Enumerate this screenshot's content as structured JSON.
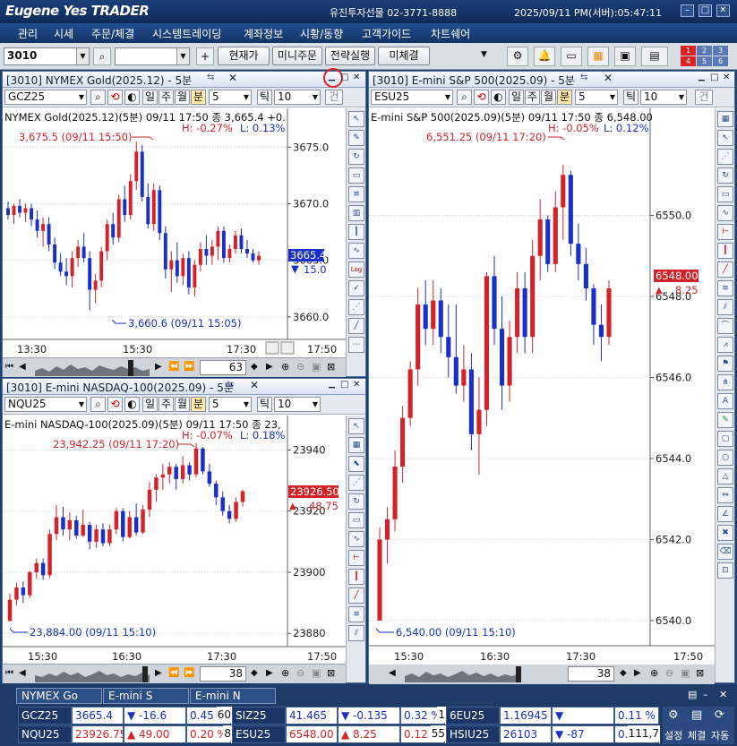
{
  "app": {
    "logo": "Eugene Yes TRADER",
    "company": "유진투자선물 02-3771-8888",
    "clock": "2025/09/11  PM(서버):05:47:11"
  },
  "menu": [
    "관리",
    "시세",
    "주문/체결",
    "시스템트레이딩",
    "계좌정보",
    "시황/동향",
    "고객가이드",
    "차트쉐어"
  ],
  "toolbar": {
    "screen_no": "3010",
    "buttons": [
      "현재가",
      "미니주문",
      "전략실행",
      "미체결"
    ],
    "badges": [
      "1",
      "2",
      "3",
      "4",
      "5",
      "6"
    ]
  },
  "chart_common": {
    "periods": [
      "일",
      "주",
      "월",
      "분"
    ],
    "minutes": "5",
    "tick_label": "틱",
    "tick_value": "10",
    "jump": "건"
  },
  "colors": {
    "up": "#d2232a",
    "down": "#1a2fc8"
  },
  "panes": {
    "gold": {
      "title": "[3010] NYMEX Gold(2025.12) - 5분",
      "symbol": "GCZ25",
      "info": "NYMEX Gold(2025.12)(5분) 09/11 17:50  종 3,665.4 +0.",
      "hl": "H: -0.27%",
      "lo_pct": "L: 0.13%",
      "high_mark": "3,675.5 (09/11 15:50)",
      "low_mark": "3,660.6 (09/11 15:05)",
      "last_tag": "3665.4",
      "change_tag": "15.0",
      "times": [
        "13:30",
        "15:30",
        "17:30",
        "17:50"
      ],
      "zoom": "63",
      "chart_data": {
        "type": "candlestick",
        "ylim": [
          3658.8,
          3677.0
        ],
        "yticks": [
          3675.0,
          3670.0,
          3665.0,
          3660.0
        ],
        "candles": [
          [
            3669.6,
            3670.2,
            3668.6,
            3669.0
          ],
          [
            3669.0,
            3670.0,
            3668.2,
            3669.8
          ],
          [
            3669.8,
            3670.4,
            3668.8,
            3669.2
          ],
          [
            3669.2,
            3670.0,
            3668.4,
            3669.6
          ],
          [
            3669.6,
            3670.0,
            3668.0,
            3668.6
          ],
          [
            3668.6,
            3669.4,
            3667.0,
            3667.6
          ],
          [
            3667.6,
            3668.8,
            3666.2,
            3668.2
          ],
          [
            3668.2,
            3668.8,
            3665.8,
            3666.4
          ],
          [
            3666.4,
            3667.0,
            3664.2,
            3664.8
          ],
          [
            3664.8,
            3665.6,
            3663.6,
            3664.0
          ],
          [
            3664.0,
            3665.2,
            3662.8,
            3663.6
          ],
          [
            3663.6,
            3665.8,
            3662.6,
            3665.2
          ],
          [
            3665.2,
            3666.8,
            3664.4,
            3666.2
          ],
          [
            3666.2,
            3667.4,
            3664.8,
            3665.2
          ],
          [
            3665.2,
            3665.8,
            3660.6,
            3662.4
          ],
          [
            3662.4,
            3663.8,
            3661.2,
            3663.2
          ],
          [
            3663.2,
            3666.2,
            3662.6,
            3665.8
          ],
          [
            3665.8,
            3668.6,
            3665.0,
            3668.2
          ],
          [
            3668.2,
            3669.2,
            3666.4,
            3667.0
          ],
          [
            3667.0,
            3670.8,
            3666.6,
            3670.4
          ],
          [
            3670.4,
            3671.6,
            3668.4,
            3669.0
          ],
          [
            3669.0,
            3672.6,
            3668.6,
            3672.0
          ],
          [
            3672.0,
            3675.5,
            3671.2,
            3674.6
          ],
          [
            3674.6,
            3675.2,
            3670.2,
            3670.6
          ],
          [
            3670.6,
            3671.8,
            3667.8,
            3668.2
          ],
          [
            3668.2,
            3671.8,
            3667.6,
            3671.2
          ],
          [
            3671.2,
            3671.6,
            3666.8,
            3667.4
          ],
          [
            3667.4,
            3668.0,
            3663.4,
            3664.2
          ],
          [
            3664.2,
            3665.8,
            3662.2,
            3665.0
          ],
          [
            3665.0,
            3666.6,
            3663.0,
            3663.6
          ],
          [
            3663.6,
            3665.6,
            3662.8,
            3665.2
          ],
          [
            3665.2,
            3665.8,
            3662.0,
            3662.6
          ],
          [
            3662.6,
            3665.0,
            3661.8,
            3664.6
          ],
          [
            3664.6,
            3666.6,
            3664.0,
            3666.0
          ],
          [
            3666.0,
            3667.2,
            3664.6,
            3665.4
          ],
          [
            3665.4,
            3666.8,
            3664.6,
            3666.2
          ],
          [
            3666.2,
            3668.0,
            3665.0,
            3667.6
          ],
          [
            3667.6,
            3668.0,
            3664.8,
            3665.2
          ],
          [
            3665.2,
            3666.4,
            3664.8,
            3666.0
          ],
          [
            3666.0,
            3667.6,
            3665.6,
            3667.2
          ],
          [
            3667.2,
            3667.8,
            3665.6,
            3666.0
          ],
          [
            3666.0,
            3666.8,
            3665.2,
            3665.6
          ],
          [
            3665.6,
            3666.0,
            3664.8,
            3665.0
          ],
          [
            3665.0,
            3665.8,
            3664.6,
            3665.4
          ]
        ]
      }
    },
    "nasdaq": {
      "title": "[3010] E-mini NASDAQ-100(2025.09) - 5분",
      "symbol": "NQU25",
      "info": "E-mini NASDAQ-100(2025.09)(5분) 09/11 17:50  종 23,",
      "hl": "H: -0.07%",
      "lo_pct": "L: 0.18%",
      "high_mark": "23,942.25 (09/11 17:20)",
      "low_mark": "23,884.00 (09/11 15:10)",
      "last_tag": "23926.50",
      "change_tag": "48.75",
      "times": [
        "15:30",
        "16:30",
        "17:30",
        "17:50"
      ],
      "zoom": "38",
      "chart_data": {
        "type": "candlestick",
        "ylim": [
          23878,
          23946
        ],
        "yticks": [
          23940,
          23920,
          23900,
          23880
        ],
        "candles": [
          [
            23884.0,
            23893.0,
            23884.0,
            23891.0
          ],
          [
            23891.0,
            23896.5,
            23889.0,
            23895.0
          ],
          [
            23895.0,
            23897.0,
            23890.0,
            23892.5
          ],
          [
            23892.5,
            23900.5,
            23891.5,
            23900.0
          ],
          [
            23900.0,
            23904.5,
            23898.0,
            23903.0
          ],
          [
            23903.0,
            23904.5,
            23897.5,
            23899.0
          ],
          [
            23899.0,
            23914.0,
            23898.0,
            23912.5
          ],
          [
            23912.5,
            23922.0,
            23910.5,
            23918.0
          ],
          [
            23918.0,
            23921.5,
            23912.0,
            23914.0
          ],
          [
            23914.0,
            23919.5,
            23910.5,
            23917.0
          ],
          [
            23917.0,
            23918.5,
            23911.0,
            23912.0
          ],
          [
            23912.0,
            23920.5,
            23911.5,
            23915.5
          ],
          [
            23915.5,
            23916.5,
            23907.5,
            23910.0
          ],
          [
            23910.0,
            23915.5,
            23908.0,
            23914.0
          ],
          [
            23914.0,
            23916.0,
            23908.5,
            23909.5
          ],
          [
            23909.5,
            23915.5,
            23908.5,
            23914.0
          ],
          [
            23914.0,
            23921.0,
            23912.5,
            23920.0
          ],
          [
            23920.0,
            23921.0,
            23910.0,
            23911.5
          ],
          [
            23911.5,
            23920.0,
            23911.0,
            23918.0
          ],
          [
            23918.0,
            23922.5,
            23912.0,
            23913.0
          ],
          [
            23913.0,
            23922.0,
            23912.5,
            23920.5
          ],
          [
            23920.5,
            23929.5,
            23918.0,
            23927.0
          ],
          [
            23927.0,
            23932.0,
            23923.0,
            23931.0
          ],
          [
            23931.0,
            23935.5,
            23927.0,
            23932.0
          ],
          [
            23932.0,
            23936.0,
            23929.0,
            23934.5
          ],
          [
            23934.5,
            23935.5,
            23927.0,
            23930.5
          ],
          [
            23930.5,
            23938.0,
            23929.0,
            23935.0
          ],
          [
            23935.0,
            23936.0,
            23930.0,
            23932.0
          ],
          [
            23932.0,
            23942.25,
            23931.0,
            23940.5
          ],
          [
            23940.5,
            23941.0,
            23932.0,
            23933.0
          ],
          [
            23933.0,
            23935.5,
            23928.0,
            23929.0
          ],
          [
            23929.0,
            23930.0,
            23922.0,
            23924.5
          ],
          [
            23924.5,
            23926.5,
            23918.5,
            23920.0
          ],
          [
            23920.0,
            23922.0,
            23916.0,
            23917.5
          ],
          [
            23917.5,
            23924.5,
            23916.5,
            23923.0
          ],
          [
            23923.0,
            23927.0,
            23921.5,
            23926.5
          ]
        ]
      }
    },
    "sp": {
      "title": "[3010] E-mini S&P 500(2025.09) - 5분",
      "symbol": "ESU25",
      "info": "E-mini S&P 500(2025.09)(5분) 09/11 17:50  종 6,548.00",
      "hl": "H: -0.05%",
      "lo_pct": "L: 0.12%",
      "high_mark": "6,551.25 (09/11 17:20)",
      "low_mark": "6,540.00 (09/11 15:10)",
      "last_tag": "6548.00",
      "change_tag": "8.25",
      "times": [
        "15:30",
        "16:30",
        "17:30",
        "17:50"
      ],
      "zoom": "38",
      "chart_data": {
        "type": "candlestick",
        "ylim": [
          6539.6,
          6552.2
        ],
        "yticks": [
          6550.0,
          6548.0,
          6546.0,
          6544.0,
          6542.0,
          6540.0
        ],
        "candles": [
          [
            6540.0,
            6542.3,
            6540.0,
            6542.0
          ],
          [
            6542.0,
            6542.8,
            6541.4,
            6542.5
          ],
          [
            6542.5,
            6544.2,
            6542.2,
            6543.8
          ],
          [
            6543.8,
            6545.3,
            6543.4,
            6545.0
          ],
          [
            6545.0,
            6546.4,
            6544.8,
            6546.2
          ],
          [
            6546.2,
            6548.2,
            6545.8,
            6547.8
          ],
          [
            6547.8,
            6548.4,
            6546.8,
            6547.2
          ],
          [
            6547.2,
            6548.4,
            6546.8,
            6547.9
          ],
          [
            6547.9,
            6548.2,
            6546.6,
            6547.0
          ],
          [
            6547.0,
            6547.8,
            6546.0,
            6546.5
          ],
          [
            6546.5,
            6547.8,
            6545.6,
            6545.8
          ],
          [
            6545.8,
            6546.8,
            6545.4,
            6546.2
          ],
          [
            6546.2,
            6546.6,
            6544.2,
            6544.6
          ],
          [
            6544.6,
            6546.0,
            6543.6,
            6545.2
          ],
          [
            6545.2,
            6548.6,
            6544.8,
            6548.5
          ],
          [
            6548.5,
            6549.0,
            6546.8,
            6547.2
          ],
          [
            6547.2,
            6548.0,
            6545.2,
            6545.8
          ],
          [
            6545.8,
            6547.4,
            6545.4,
            6547.0
          ],
          [
            6547.0,
            6548.6,
            6546.6,
            6548.2
          ],
          [
            6548.2,
            6548.6,
            6546.6,
            6547.0
          ],
          [
            6547.0,
            6549.4,
            6546.6,
            6549.0
          ],
          [
            6549.0,
            6550.4,
            6548.4,
            6549.9
          ],
          [
            6549.9,
            6550.0,
            6548.6,
            6548.8
          ],
          [
            6548.8,
            6550.6,
            6548.6,
            6550.2
          ],
          [
            6550.2,
            6551.25,
            6549.4,
            6551.0
          ],
          [
            6551.0,
            6551.1,
            6549.0,
            6549.3
          ],
          [
            6549.3,
            6549.8,
            6548.4,
            6548.8
          ],
          [
            6548.8,
            6549.2,
            6547.9,
            6548.2
          ],
          [
            6548.2,
            6548.3,
            6546.8,
            6547.3
          ],
          [
            6547.3,
            6547.8,
            6546.4,
            6547.0
          ],
          [
            6547.0,
            6548.4,
            6546.8,
            6548.2
          ]
        ]
      }
    }
  },
  "bottom": {
    "tabs": [
      "NYMEX Go",
      "E-mini S",
      "E-mini N"
    ],
    "rows": [
      [
        {
          "sym": "GCZ25",
          "last": "3665.4",
          "dir": "down",
          "chg": "-16.6",
          "pct": "0.45 %",
          "vol": "60"
        },
        {
          "sym": "SIZ25",
          "last": "41.465",
          "dir": "down",
          "chg": "-0.135",
          "pct": "0.32 %",
          "vol": "1"
        },
        {
          "sym": "6EU25",
          "last": "1.16945",
          "dir": "down",
          "chg": "-0.00140",
          "pct": "0.11 %",
          "vol": ""
        }
      ],
      [
        {
          "sym": "NQU25",
          "last": "23926.75",
          "dir": "up",
          "chg": "49.00",
          "pct": "0.20 %",
          "vol": "8"
        },
        {
          "sym": "ESU25",
          "last": "6548.00",
          "dir": "up",
          "chg": "8.25",
          "pct": "0.12 %",
          "vol": "55"
        },
        {
          "sym": "HSIU25",
          "last": "26103",
          "dir": "down",
          "chg": "-87",
          "pct": "0.33 %",
          "vol": "111,7"
        }
      ]
    ],
    "side": [
      "설정",
      "체결",
      "자동"
    ]
  }
}
